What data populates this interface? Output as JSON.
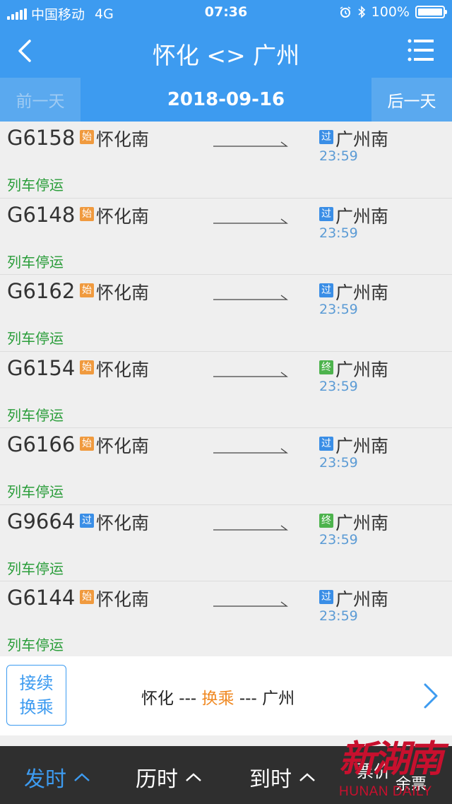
{
  "status_bar": {
    "carrier": "中国移动",
    "network": "4G",
    "time": "07:36",
    "battery": "100%",
    "battery_level": 1.0
  },
  "nav": {
    "title": "怀化 <> 广州",
    "back_icon": "chevron-left-icon",
    "menu_icon": "menu-icon"
  },
  "date_bar": {
    "prev_label": "前一天",
    "date": "2018-09-16",
    "next_label": "后一天"
  },
  "trains": [
    {
      "no": "G6158",
      "dep_badge": "始",
      "dep_type": "shi",
      "dep_station": "怀化南",
      "arr_badge": "过",
      "arr_type": "guo",
      "arr_station": "广州南",
      "arr_time": "23:59",
      "status": "列车停运"
    },
    {
      "no": "G6148",
      "dep_badge": "始",
      "dep_type": "shi",
      "dep_station": "怀化南",
      "arr_badge": "过",
      "arr_type": "guo",
      "arr_station": "广州南",
      "arr_time": "23:59",
      "status": "列车停运"
    },
    {
      "no": "G6162",
      "dep_badge": "始",
      "dep_type": "shi",
      "dep_station": "怀化南",
      "arr_badge": "过",
      "arr_type": "guo",
      "arr_station": "广州南",
      "arr_time": "23:59",
      "status": "列车停运"
    },
    {
      "no": "G6154",
      "dep_badge": "始",
      "dep_type": "shi",
      "dep_station": "怀化南",
      "arr_badge": "终",
      "arr_type": "zhong",
      "arr_station": "广州南",
      "arr_time": "23:59",
      "status": "列车停运"
    },
    {
      "no": "G6166",
      "dep_badge": "始",
      "dep_type": "shi",
      "dep_station": "怀化南",
      "arr_badge": "过",
      "arr_type": "guo",
      "arr_station": "广州南",
      "arr_time": "23:59",
      "status": "列车停运"
    },
    {
      "no": "G9664",
      "dep_badge": "过",
      "dep_type": "guo",
      "dep_station": "怀化南",
      "arr_badge": "终",
      "arr_type": "zhong",
      "arr_station": "广州南",
      "arr_time": "23:59",
      "status": "列车停运"
    },
    {
      "no": "G6144",
      "dep_badge": "始",
      "dep_type": "shi",
      "dep_station": "怀化南",
      "arr_badge": "过",
      "arr_type": "guo",
      "arr_station": "广州南",
      "arr_time": "23:59",
      "status": "列车停运"
    }
  ],
  "transfer": {
    "button_line1": "接续",
    "button_line2": "换乘",
    "from": "怀化",
    "sep1": " --- ",
    "mid": "换乘",
    "sep2": " --- ",
    "to": "广州"
  },
  "bottom_bar": {
    "sort_depart": "发时",
    "sort_duration": "历时",
    "sort_arrive": "到时",
    "sort_ticket": "票价"
  },
  "watermark": {
    "logo": "新湖南",
    "sub": "HUNAN DAILY",
    "ticket_overlay": "余票"
  },
  "colors": {
    "primary": "#3d9bf0",
    "status_green": "#2a9d3a",
    "badge_shi": "#f09a3e",
    "badge_guo": "#3a8ee6",
    "badge_zhong": "#4db34d",
    "transfer_accent": "#f08a24"
  }
}
